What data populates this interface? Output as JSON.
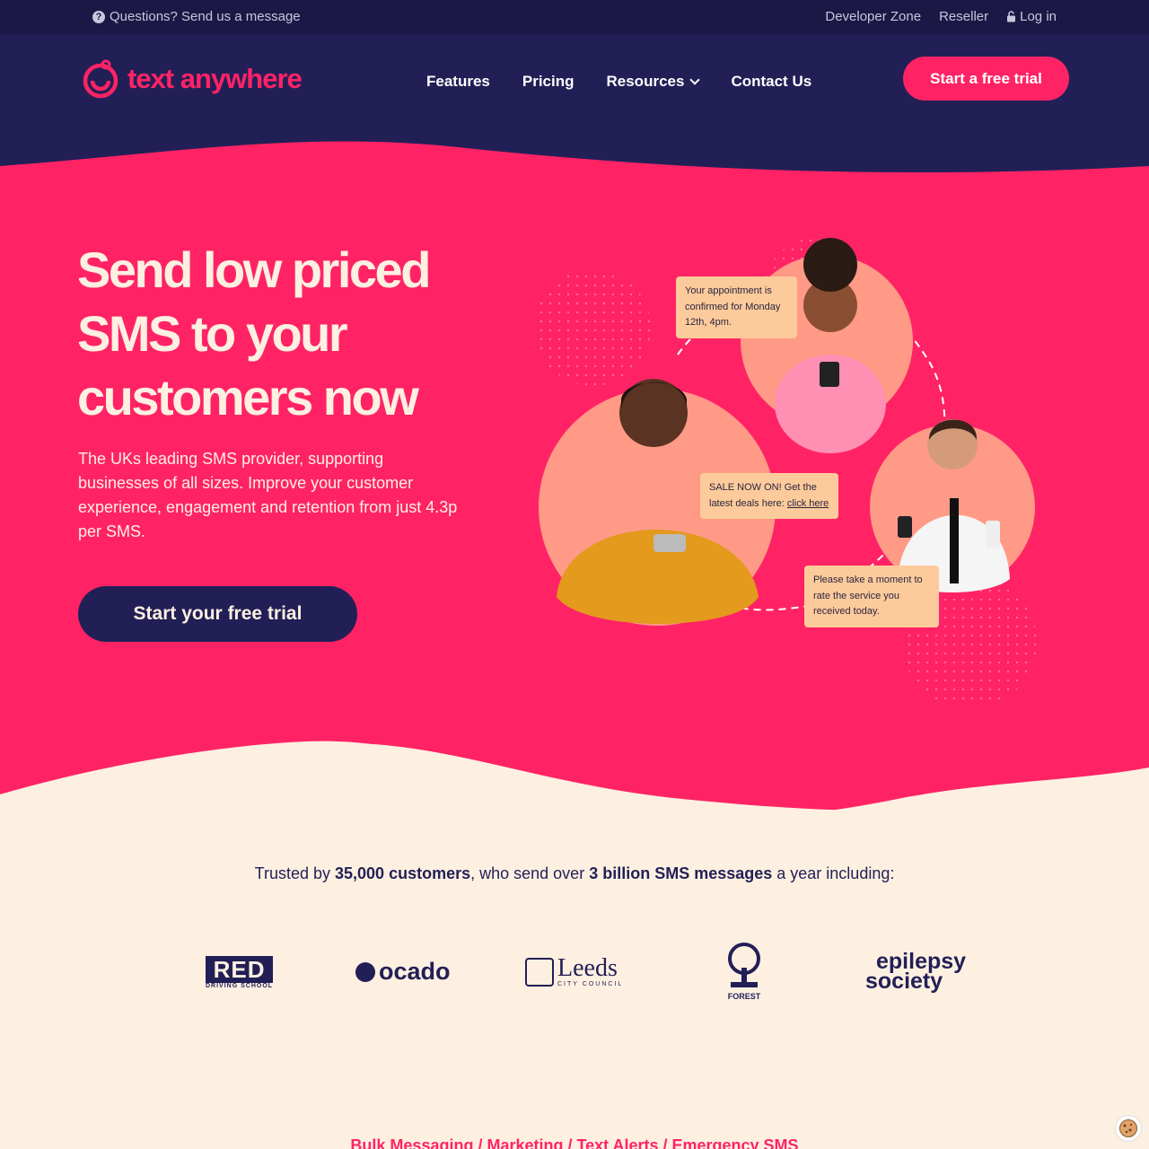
{
  "topbar": {
    "question_text": "Questions? Send us a message",
    "links": [
      "Developer Zone",
      "Reseller",
      "Log in"
    ]
  },
  "header": {
    "logo_text": "text anywhere",
    "nav": [
      "Features",
      "Pricing",
      "Resources",
      "Contact Us"
    ],
    "cta": "Start a free trial"
  },
  "hero": {
    "headline": "Send low priced SMS to your customers now",
    "subtext": "The UKs leading SMS provider, supporting businesses of all sizes. Improve your customer experience, engagement and retention from just 4.3p per SMS.",
    "cta": "Start your free trial",
    "bubbles": {
      "appointment": "Your appointment is confirmed for Monday 12th, 4pm.",
      "sale": "SALE NOW ON! Get the latest deals here:",
      "sale_link": "click here",
      "rate": "Please take a moment to rate the service you received today."
    }
  },
  "trusted": {
    "prefix": "Trusted by ",
    "customers": "35,000 customers",
    "middle": ", who send over ",
    "messages": "3 billion SMS messages",
    "suffix": " a year including:"
  },
  "logos": {
    "red": "RED",
    "red_sub": "DRIVING SCHOOL",
    "ocado": "ocado",
    "leeds": "Leeds",
    "leeds_sub": "CITY COUNCIL",
    "forest": "FOREST",
    "epilepsy_line1": "epilepsy",
    "epilepsy_line2": "society"
  },
  "bottom_categories": "Bulk Messaging / Marketing / Text Alerts / Emergency SMS",
  "colors": {
    "navy": "#221f56",
    "pink": "#ff2366",
    "cream": "#fdf0e1",
    "peach": "#fdcb9b"
  }
}
